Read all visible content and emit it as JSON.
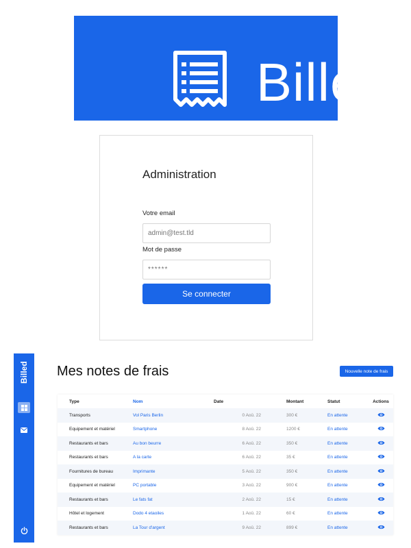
{
  "logo": {
    "brand": "Billed",
    "icon": "receipt-icon"
  },
  "login": {
    "title": "Administration",
    "email_label": "Votre email",
    "email_placeholder": "admin@test.tld",
    "password_label": "Mot de passe",
    "password_placeholder": "******",
    "submit_label": "Se connecter"
  },
  "sidebar": {
    "brand": "Billed",
    "items": [
      {
        "icon": "window-icon",
        "active": true
      },
      {
        "icon": "mail-icon",
        "active": false
      }
    ],
    "logout_icon": "power-icon"
  },
  "dashboard": {
    "title": "Mes notes de frais",
    "new_bill_label": "Nouvelle note de frais",
    "columns": [
      "Type",
      "Nom",
      "Date",
      "Montant",
      "Statut",
      "Actions"
    ],
    "rows": [
      {
        "type": "Transports",
        "nom": "Vol Paris Berlin",
        "date": "0 Aoû. 22",
        "montant": "300 €",
        "statut": "En attente"
      },
      {
        "type": "Equipement et matériel",
        "nom": "Smartphone",
        "date": "8 Aoû. 22",
        "montant": "1200 €",
        "statut": "En attente"
      },
      {
        "type": "Restaurants et bars",
        "nom": "Au bon beurre",
        "date": "6 Aoû. 22",
        "montant": "350 €",
        "statut": "En attente"
      },
      {
        "type": "Restaurants et bars",
        "nom": "A la carte",
        "date": "6 Aoû. 22",
        "montant": "35 €",
        "statut": "En attente"
      },
      {
        "type": "Fournitures de bureau",
        "nom": "Imprimante",
        "date": "5 Aoû. 22",
        "montant": "350 €",
        "statut": "En attente"
      },
      {
        "type": "Equipement et matériel",
        "nom": "PC portable",
        "date": "3 Aoû. 22",
        "montant": "900 €",
        "statut": "En attente"
      },
      {
        "type": "Restaurants et bars",
        "nom": "Le fats fat",
        "date": "2 Aoû. 22",
        "montant": "15 €",
        "statut": "En attente"
      },
      {
        "type": "Hôtel et logement",
        "nom": "Dodo 4 etaoiles",
        "date": "1 Aoû. 22",
        "montant": "60 €",
        "statut": "En attente"
      },
      {
        "type": "Restaurants et bars",
        "nom": "La Tour d'argent",
        "date": "9 Aoû. 22",
        "montant": "899 €",
        "statut": "En attente"
      }
    ]
  },
  "colors": {
    "primary": "#1a66e8",
    "active_nav": "#8ab0f2",
    "row_alt": "#f3f6fb"
  }
}
